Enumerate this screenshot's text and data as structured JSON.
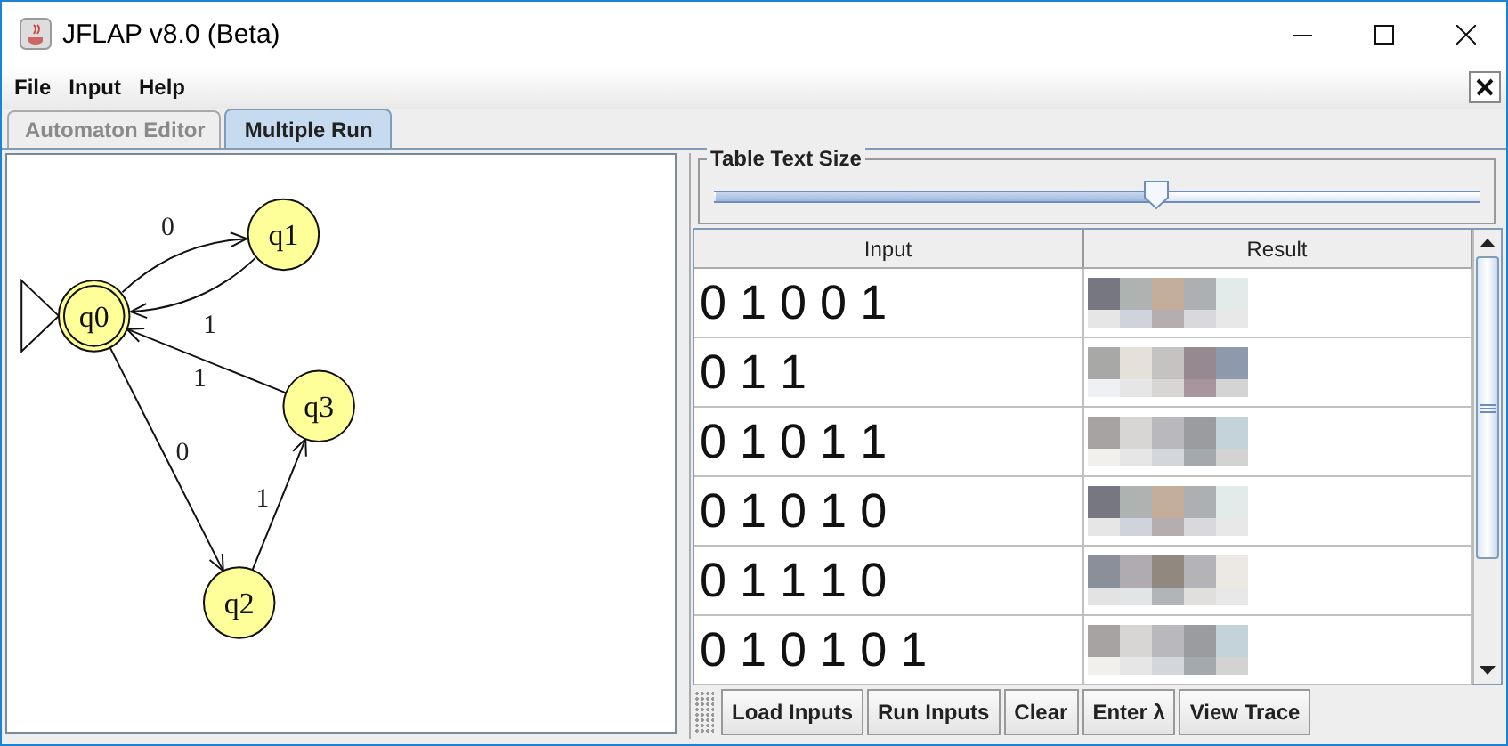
{
  "window": {
    "title": "JFLAP v8.0 (Beta)"
  },
  "menu": [
    "File",
    "Input",
    "Help"
  ],
  "tabs": [
    {
      "label": "Automaton Editor",
      "selected": false
    },
    {
      "label": "Multiple Run",
      "selected": true
    }
  ],
  "automaton": {
    "states": [
      {
        "name": "q0",
        "initial": true,
        "final": true
      },
      {
        "name": "q1",
        "initial": false,
        "final": false
      },
      {
        "name": "q2",
        "initial": false,
        "final": false
      },
      {
        "name": "q3",
        "initial": false,
        "final": false
      }
    ],
    "transitions": [
      {
        "label": "0"
      },
      {
        "label": "1"
      },
      {
        "label": "1"
      },
      {
        "label": "0"
      },
      {
        "label": "1"
      }
    ]
  },
  "slider": {
    "label": "Table Text Size",
    "level": 0.58
  },
  "table": {
    "columns": [
      "Input",
      "Result"
    ],
    "rows": [
      {
        "input": "0 1 0 0 1"
      },
      {
        "input": "0 1 1"
      },
      {
        "input": "0 1 0 1 1"
      },
      {
        "input": "0 1 0 1 0"
      },
      {
        "input": "0 1 1 1 0"
      },
      {
        "input": "0 1 0 1 0 1"
      }
    ]
  },
  "buttons": [
    "Load Inputs",
    "Run Inputs",
    "Clear",
    "Enter λ",
    "View Trace"
  ]
}
